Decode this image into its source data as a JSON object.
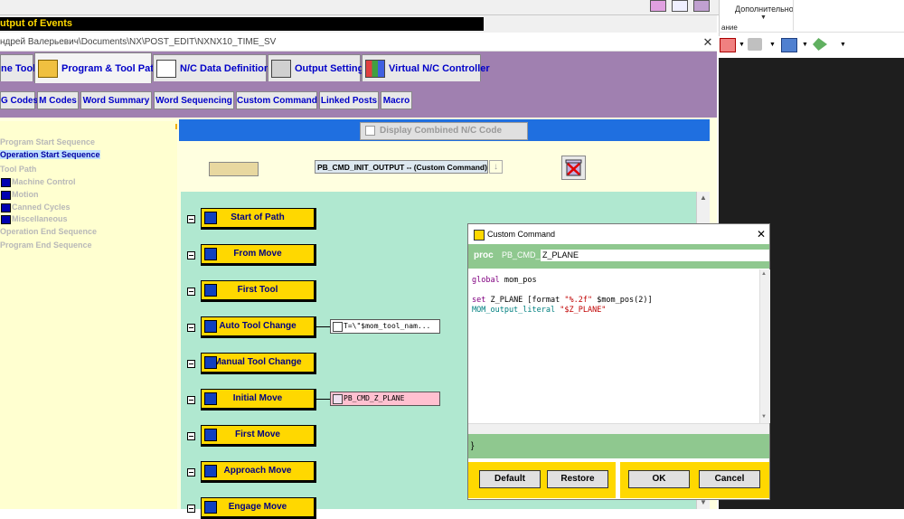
{
  "window": {
    "events_title": "utput of Events",
    "path": "ндрей Валерьевич\\Documents\\NX\\POST_EDIT\\NXNX10_TIME_SV",
    "close_glyph": "✕"
  },
  "ribbon": {
    "label": "Дополнительно",
    "label2": "ание"
  },
  "main_tabs": [
    {
      "label": "ne Tool"
    },
    {
      "label": "Program & Tool Path",
      "active": true
    },
    {
      "label": "N/C Data Definitions"
    },
    {
      "label": "Output Settings"
    },
    {
      "label": "Virtual N/C Controller"
    }
  ],
  "sub_tabs": [
    {
      "label": "G Codes"
    },
    {
      "label": "M Codes"
    },
    {
      "label": "Word Summary"
    },
    {
      "label": "Word Sequencing"
    },
    {
      "label": "Custom Command"
    },
    {
      "label": "Linked Posts"
    },
    {
      "label": "Macro"
    }
  ],
  "tree": [
    {
      "label": "Program Start Sequence",
      "indent": 0,
      "icon": false,
      "selected": false
    },
    {
      "label": "Operation Start Sequence",
      "indent": 0,
      "icon": false,
      "selected": true
    },
    {
      "label": "Tool Path",
      "indent": 0,
      "icon": false,
      "selected": false
    },
    {
      "label": "Machine Control",
      "indent": 1,
      "icon": true,
      "selected": false
    },
    {
      "label": "Motion",
      "indent": 1,
      "icon": true,
      "selected": false
    },
    {
      "label": "Canned Cycles",
      "indent": 1,
      "icon": true,
      "selected": false
    },
    {
      "label": "Miscellaneous",
      "indent": 1,
      "icon": true,
      "selected": false
    },
    {
      "label": "Operation End Sequence",
      "indent": 0,
      "icon": false,
      "selected": false
    },
    {
      "label": "Program End Sequence",
      "indent": 0,
      "icon": false,
      "selected": false
    }
  ],
  "center": {
    "combined_label": "Display Combined N/C Code Blocks",
    "selected_command": "PB_CMD_INIT_OUTPUT -- (Custom Command)",
    "dropdown_glyph": "↓"
  },
  "events": [
    {
      "label": "Start of Path",
      "chip": ""
    },
    {
      "label": "From Move",
      "chip": ""
    },
    {
      "label": "First Tool",
      "chip": ""
    },
    {
      "label": "Auto Tool Change",
      "chip": "T=\\\"$mom_tool_nam..."
    },
    {
      "label": "Manual Tool Change",
      "chip": ""
    },
    {
      "label": "Initial Move",
      "chip": "PB_CMD_Z_PLANE",
      "chip_pink": true
    },
    {
      "label": "First Move",
      "chip": ""
    },
    {
      "label": "Approach Move",
      "chip": ""
    },
    {
      "label": "Engage Move",
      "chip": ""
    }
  ],
  "dialog": {
    "title": "Custom Command",
    "close_glyph": "✕",
    "proc_kw": "proc",
    "proc_prefix": "PB_CMD_",
    "proc_name": "Z_PLANE",
    "code": {
      "l1_kw": "global",
      "l1_rest": " mom_pos",
      "l3_kw": "set",
      "l3_a": " Z_PLANE [format ",
      "l3_str": "\"%.2f\"",
      "l3_b": " $mom_pos(2)]",
      "l4_mom": "MOM_output_literal",
      "l4_sp": " ",
      "l4_str": "\"$Z_PLANE\""
    },
    "close_brace": "}",
    "buttons": {
      "default": "Default",
      "restore": "Restore",
      "ok": "OK",
      "cancel": "Cancel"
    }
  },
  "colors": {
    "tab_bg": "#a080b0",
    "canvas_bg": "#b0e8d0",
    "event_button": "#ffd800",
    "blue_bar": "#1f6fe0",
    "tree_bg": "#ffffd0",
    "dialog_green": "#8fc88f"
  },
  "icons": [
    "book-icon",
    "tool-icon",
    "trash-icon",
    "event-icon",
    "cube-icon",
    "printer-icon",
    "chart-icon"
  ]
}
